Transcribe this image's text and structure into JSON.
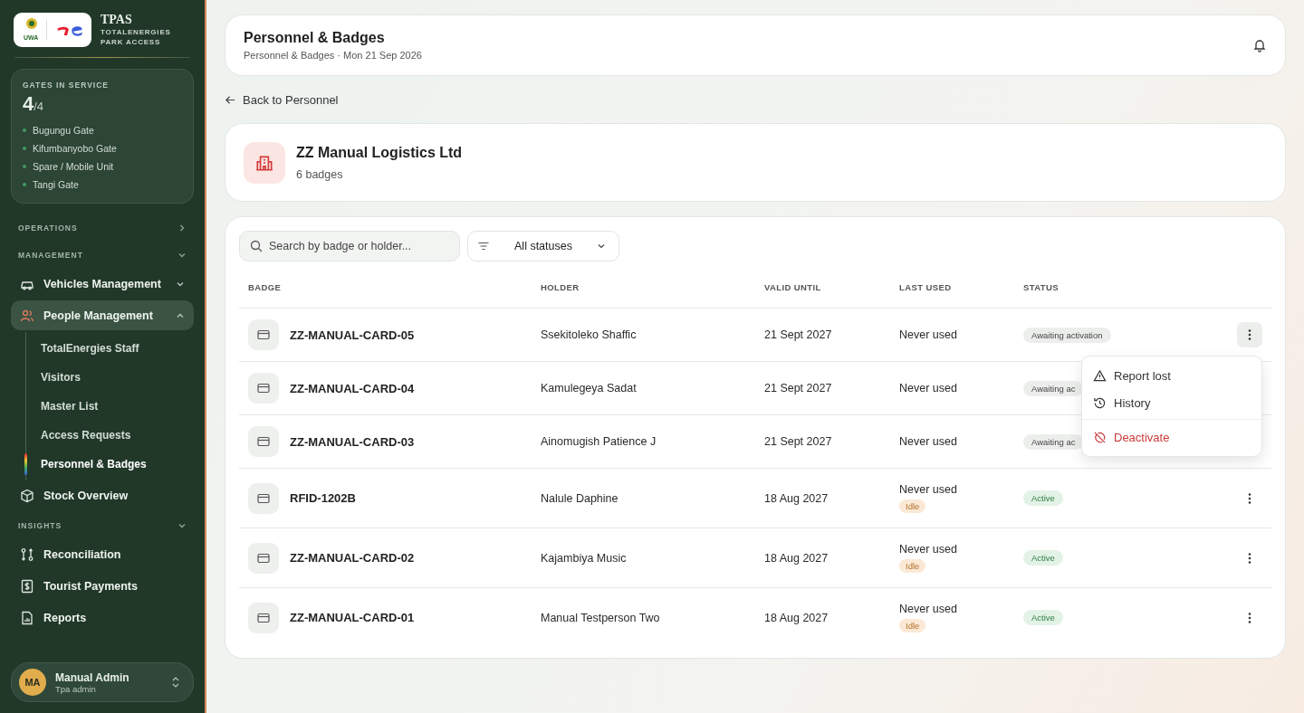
{
  "brand": {
    "logo_text": "UWA",
    "title": "TPAS",
    "subtitle": "TOTALENERGIES PARK ACCESS"
  },
  "gates": {
    "label": "GATES IN SERVICE",
    "count": "4",
    "total": "/4",
    "items": [
      {
        "name": "Bugungu Gate",
        "color": "#3f9a5e"
      },
      {
        "name": "Kifumbanyobo Gate",
        "color": "#3f9a5e"
      },
      {
        "name": "Spare / Mobile Unit",
        "color": "#3f9a5e"
      },
      {
        "name": "Tangi Gate",
        "color": "#3f9a5e"
      }
    ]
  },
  "nav": [
    {
      "label": "OPERATIONS",
      "expanded": false
    },
    {
      "label": "MANAGEMENT",
      "expanded": true,
      "items": [
        {
          "label": "Vehicles Management",
          "expanded": false,
          "selected": false
        },
        {
          "label": "People Management",
          "expanded": true,
          "selected": true,
          "children": [
            {
              "label": "TotalEnergies Staff",
              "selected": false
            },
            {
              "label": "Visitors",
              "selected": false
            },
            {
              "label": "Master List",
              "selected": false
            },
            {
              "label": "Access Requests",
              "selected": false
            },
            {
              "label": "Personnel & Badges",
              "selected": true
            }
          ]
        },
        {
          "label": "Stock Overview",
          "selected": false
        }
      ]
    },
    {
      "label": "INSIGHTS",
      "expanded": true,
      "items": [
        {
          "label": "Reconciliation",
          "selected": false
        },
        {
          "label": "Tourist Payments",
          "selected": false
        },
        {
          "label": "Reports",
          "selected": false
        }
      ]
    }
  ],
  "user": {
    "initials": "MA",
    "name": "Manual Admin",
    "role": "Tpa admin"
  },
  "header": {
    "title": "Personnel & Badges",
    "subtitle": "Personnel & Badges · Mon 21 Sep 2026"
  },
  "back_link": "Back to Personnel",
  "company": {
    "name": "ZZ Manual Logistics Ltd",
    "count": "6 badges"
  },
  "search": {
    "placeholder": "Search by badge or holder..."
  },
  "status_filter": "All statuses",
  "table": {
    "columns": [
      "BADGE",
      "HOLDER",
      "VALID UNTIL",
      "LAST USED",
      "STATUS"
    ],
    "rows": [
      {
        "badge": "ZZ-MANUAL-CARD-05",
        "holder": "Ssekitoleko Shaffic",
        "valid_until": "21 Sept 2027",
        "last_used": "Never used",
        "status": {
          "label": "Awaiting activation",
          "kind": "awaiting"
        },
        "menu_open": true
      },
      {
        "badge": "ZZ-MANUAL-CARD-04",
        "holder": "Kamulegeya Sadat",
        "valid_until": "21 Sept 2027",
        "last_used": "Never used",
        "status": {
          "label": "Awaiting ac",
          "kind": "awaiting"
        }
      },
      {
        "badge": "ZZ-MANUAL-CARD-03",
        "holder": "Ainomugish Patience J",
        "valid_until": "21 Sept 2027",
        "last_used": "Never used",
        "status": {
          "label": "Awaiting ac",
          "kind": "awaiting"
        }
      },
      {
        "badge": "RFID-1202B",
        "holder": "Nalule Daphine",
        "valid_until": "18 Aug 2027",
        "last_used": "Never used",
        "activity": "Idle",
        "status": {
          "label": "Active",
          "kind": "active"
        },
        "menu_open": false
      },
      {
        "badge": "ZZ-MANUAL-CARD-02",
        "holder": "Kajambiya Music",
        "valid_until": "18 Aug 2027",
        "last_used": "Never used",
        "activity": "Idle",
        "status": {
          "label": "Active",
          "kind": "active"
        },
        "menu_open": false
      },
      {
        "badge": "ZZ-MANUAL-CARD-01",
        "holder": "Manual Testperson Two",
        "valid_until": "18 Aug 2027",
        "last_used": "Never used",
        "activity": "Idle",
        "status": {
          "label": "Active",
          "kind": "active"
        },
        "menu_open": false
      }
    ]
  },
  "row_menu": [
    {
      "label": "Report lost",
      "danger": false
    },
    {
      "label": "History",
      "danger": false
    },
    {
      "label": "Deactivate",
      "danger": true
    }
  ]
}
